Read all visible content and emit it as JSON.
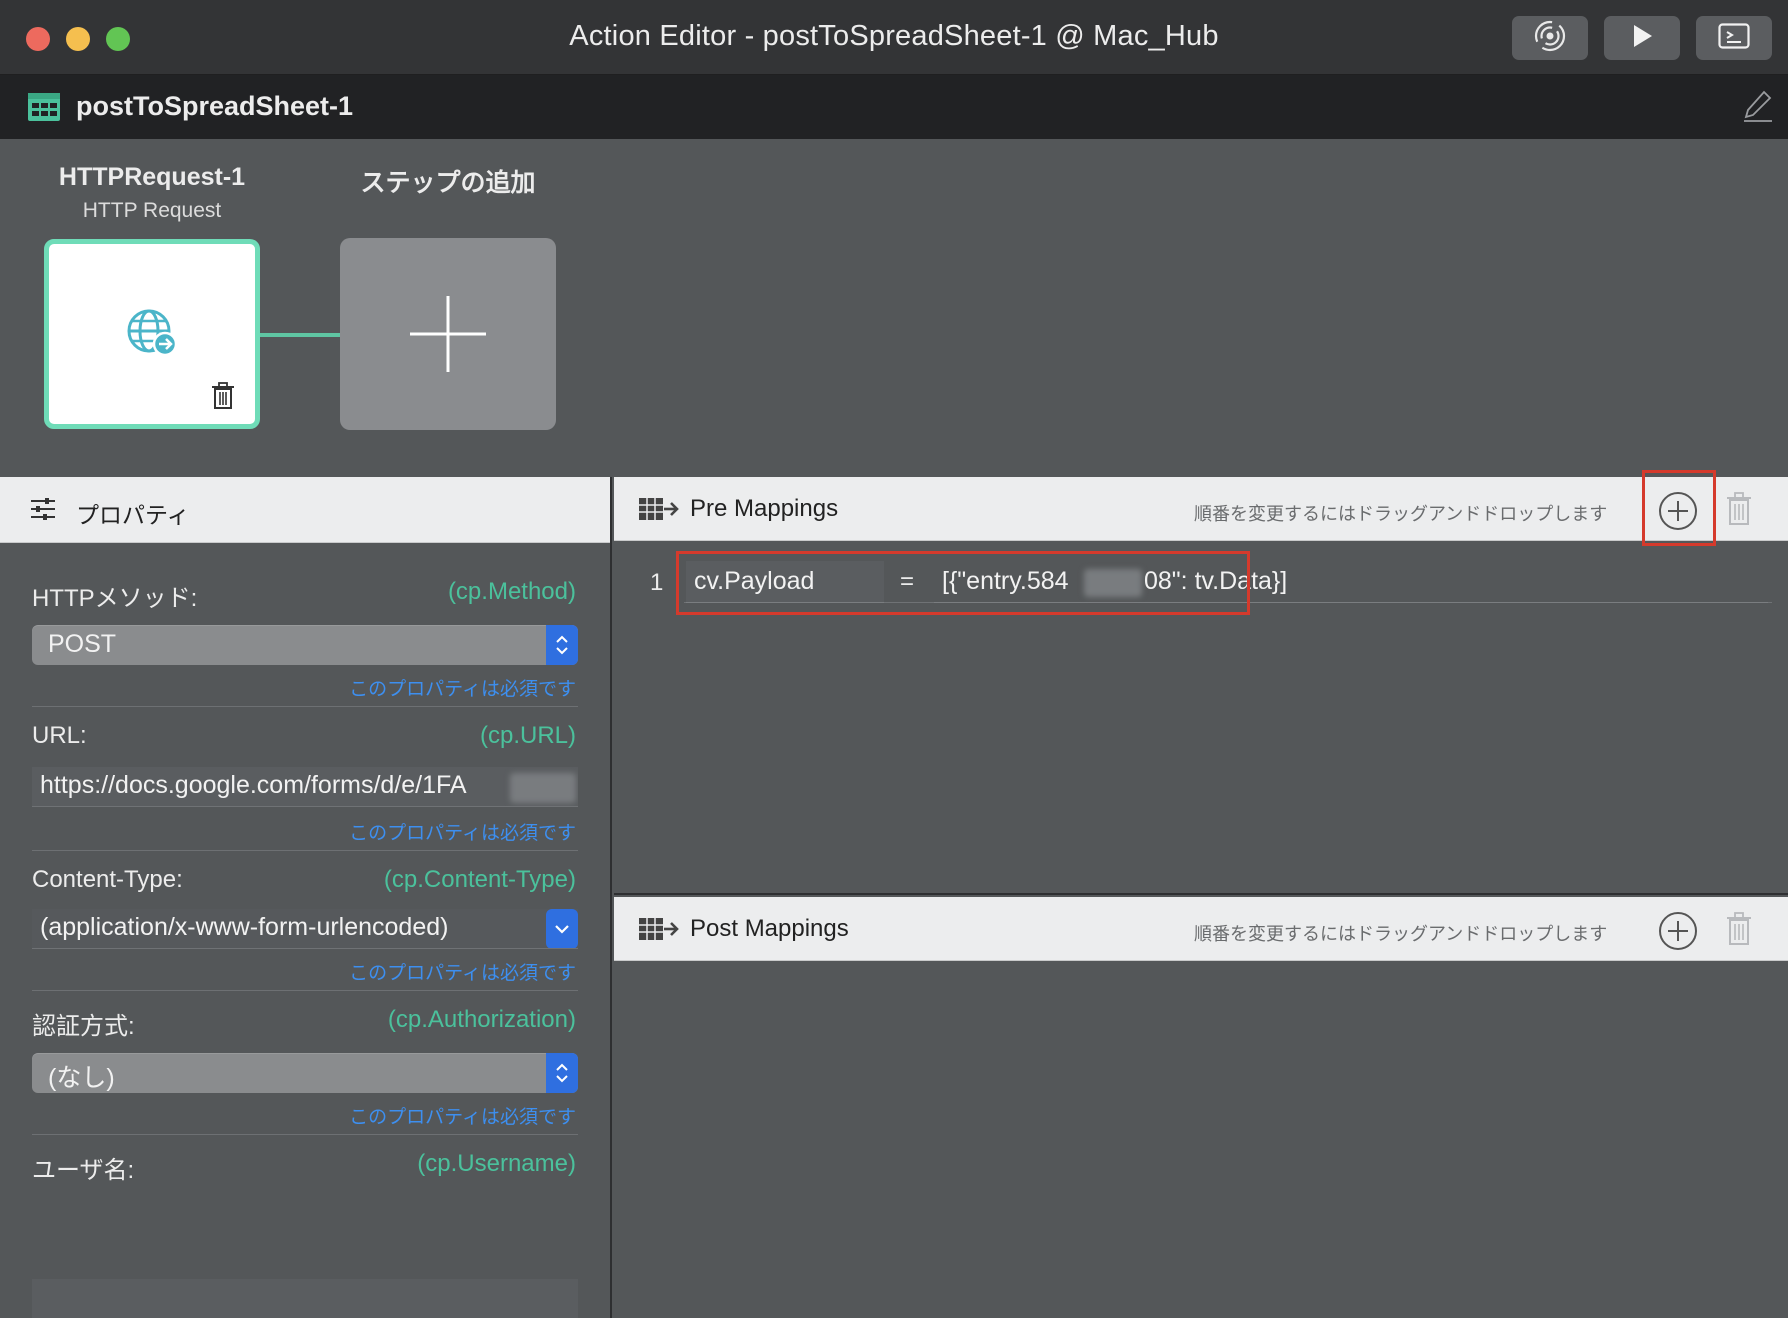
{
  "window": {
    "title": "Action Editor - postToSpreadSheet-1 @ Mac_Hub",
    "toolbar_icons": [
      "broadcast-icon",
      "play-icon",
      "terminal-icon"
    ]
  },
  "action": {
    "name": "postToSpreadSheet-1",
    "icon": "action-table-icon",
    "edit_icon": "pencil-icon"
  },
  "steps": [
    {
      "name": "HTTPRequest-1",
      "type": "HTTP Request",
      "icon": "globe-arrow-icon",
      "delete_icon": "trash-icon",
      "selected": true
    }
  ],
  "add_step": {
    "label": "ステップの追加",
    "icon": "plus-icon"
  },
  "properties": {
    "header": "プロパティ",
    "header_icon": "sliders-icon",
    "required_note": "このプロパティは必須です",
    "items": [
      {
        "label": "HTTPメソッド:",
        "var": "(cp.Method)",
        "kind": "select",
        "value": "POST"
      },
      {
        "label": "URL:",
        "var": "(cp.URL)",
        "kind": "text",
        "value": "https://docs.google.com/forms/d/e/1FA"
      },
      {
        "label": "Content-Type:",
        "var": "(cp.Content-Type)",
        "kind": "dropdown",
        "value": "(application/x-www-form-urlencoded)"
      },
      {
        "label": "認証方式:",
        "var": "(cp.Authorization)",
        "kind": "select",
        "value": "(なし)"
      },
      {
        "label": "ユーザ名:",
        "var": "(cp.Username)",
        "kind": "text",
        "value": ""
      }
    ]
  },
  "pre_mappings": {
    "title": "Pre Mappings",
    "hint": "順番を変更するにはドラッグアンドドロップします",
    "icon": "mapping-arrow-icon",
    "rows": [
      {
        "index": "1",
        "target": "cv.Payload",
        "operator": "=",
        "value_start": "[{\"entry.584",
        "value_end": "08\": tv.Data}]"
      }
    ]
  },
  "post_mappings": {
    "title": "Post Mappings",
    "hint": "順番を変更するにはドラッグアンドドロップします",
    "icon": "mapping-arrow-icon",
    "rows": []
  },
  "colors": {
    "accent_green": "#4bc19c",
    "step_border": "#6fdcb8",
    "link_blue": "#3d8ff0",
    "highlight_red": "#d53a2c",
    "select_blue": "#2f6fe0"
  }
}
